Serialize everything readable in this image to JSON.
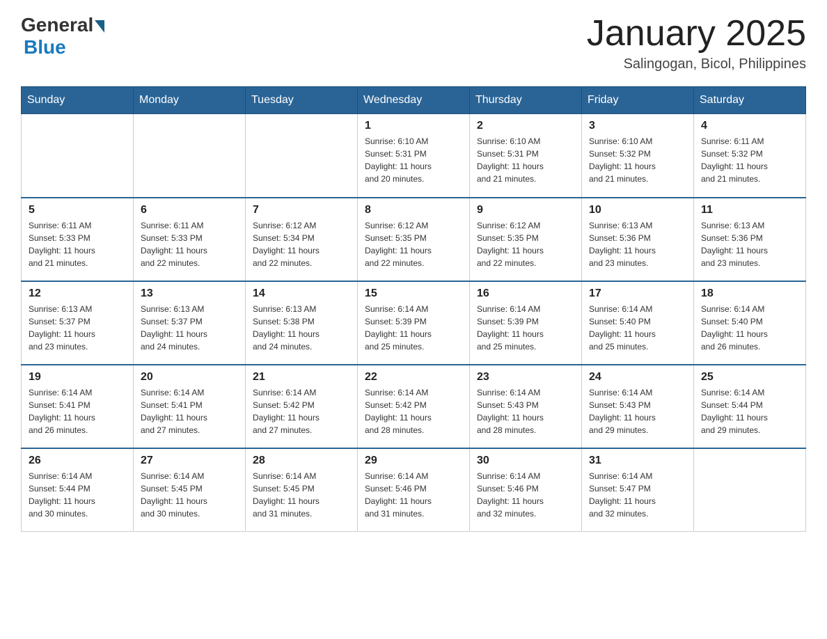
{
  "header": {
    "logo": {
      "text_general": "General",
      "text_blue": "Blue"
    },
    "title": "January 2025",
    "subtitle": "Salingogan, Bicol, Philippines"
  },
  "days_of_week": [
    "Sunday",
    "Monday",
    "Tuesday",
    "Wednesday",
    "Thursday",
    "Friday",
    "Saturday"
  ],
  "weeks": [
    {
      "days": [
        {
          "num": "",
          "info": ""
        },
        {
          "num": "",
          "info": ""
        },
        {
          "num": "",
          "info": ""
        },
        {
          "num": "1",
          "info": "Sunrise: 6:10 AM\nSunset: 5:31 PM\nDaylight: 11 hours\nand 20 minutes."
        },
        {
          "num": "2",
          "info": "Sunrise: 6:10 AM\nSunset: 5:31 PM\nDaylight: 11 hours\nand 21 minutes."
        },
        {
          "num": "3",
          "info": "Sunrise: 6:10 AM\nSunset: 5:32 PM\nDaylight: 11 hours\nand 21 minutes."
        },
        {
          "num": "4",
          "info": "Sunrise: 6:11 AM\nSunset: 5:32 PM\nDaylight: 11 hours\nand 21 minutes."
        }
      ]
    },
    {
      "days": [
        {
          "num": "5",
          "info": "Sunrise: 6:11 AM\nSunset: 5:33 PM\nDaylight: 11 hours\nand 21 minutes."
        },
        {
          "num": "6",
          "info": "Sunrise: 6:11 AM\nSunset: 5:33 PM\nDaylight: 11 hours\nand 22 minutes."
        },
        {
          "num": "7",
          "info": "Sunrise: 6:12 AM\nSunset: 5:34 PM\nDaylight: 11 hours\nand 22 minutes."
        },
        {
          "num": "8",
          "info": "Sunrise: 6:12 AM\nSunset: 5:35 PM\nDaylight: 11 hours\nand 22 minutes."
        },
        {
          "num": "9",
          "info": "Sunrise: 6:12 AM\nSunset: 5:35 PM\nDaylight: 11 hours\nand 22 minutes."
        },
        {
          "num": "10",
          "info": "Sunrise: 6:13 AM\nSunset: 5:36 PM\nDaylight: 11 hours\nand 23 minutes."
        },
        {
          "num": "11",
          "info": "Sunrise: 6:13 AM\nSunset: 5:36 PM\nDaylight: 11 hours\nand 23 minutes."
        }
      ]
    },
    {
      "days": [
        {
          "num": "12",
          "info": "Sunrise: 6:13 AM\nSunset: 5:37 PM\nDaylight: 11 hours\nand 23 minutes."
        },
        {
          "num": "13",
          "info": "Sunrise: 6:13 AM\nSunset: 5:37 PM\nDaylight: 11 hours\nand 24 minutes."
        },
        {
          "num": "14",
          "info": "Sunrise: 6:13 AM\nSunset: 5:38 PM\nDaylight: 11 hours\nand 24 minutes."
        },
        {
          "num": "15",
          "info": "Sunrise: 6:14 AM\nSunset: 5:39 PM\nDaylight: 11 hours\nand 25 minutes."
        },
        {
          "num": "16",
          "info": "Sunrise: 6:14 AM\nSunset: 5:39 PM\nDaylight: 11 hours\nand 25 minutes."
        },
        {
          "num": "17",
          "info": "Sunrise: 6:14 AM\nSunset: 5:40 PM\nDaylight: 11 hours\nand 25 minutes."
        },
        {
          "num": "18",
          "info": "Sunrise: 6:14 AM\nSunset: 5:40 PM\nDaylight: 11 hours\nand 26 minutes."
        }
      ]
    },
    {
      "days": [
        {
          "num": "19",
          "info": "Sunrise: 6:14 AM\nSunset: 5:41 PM\nDaylight: 11 hours\nand 26 minutes."
        },
        {
          "num": "20",
          "info": "Sunrise: 6:14 AM\nSunset: 5:41 PM\nDaylight: 11 hours\nand 27 minutes."
        },
        {
          "num": "21",
          "info": "Sunrise: 6:14 AM\nSunset: 5:42 PM\nDaylight: 11 hours\nand 27 minutes."
        },
        {
          "num": "22",
          "info": "Sunrise: 6:14 AM\nSunset: 5:42 PM\nDaylight: 11 hours\nand 28 minutes."
        },
        {
          "num": "23",
          "info": "Sunrise: 6:14 AM\nSunset: 5:43 PM\nDaylight: 11 hours\nand 28 minutes."
        },
        {
          "num": "24",
          "info": "Sunrise: 6:14 AM\nSunset: 5:43 PM\nDaylight: 11 hours\nand 29 minutes."
        },
        {
          "num": "25",
          "info": "Sunrise: 6:14 AM\nSunset: 5:44 PM\nDaylight: 11 hours\nand 29 minutes."
        }
      ]
    },
    {
      "days": [
        {
          "num": "26",
          "info": "Sunrise: 6:14 AM\nSunset: 5:44 PM\nDaylight: 11 hours\nand 30 minutes."
        },
        {
          "num": "27",
          "info": "Sunrise: 6:14 AM\nSunset: 5:45 PM\nDaylight: 11 hours\nand 30 minutes."
        },
        {
          "num": "28",
          "info": "Sunrise: 6:14 AM\nSunset: 5:45 PM\nDaylight: 11 hours\nand 31 minutes."
        },
        {
          "num": "29",
          "info": "Sunrise: 6:14 AM\nSunset: 5:46 PM\nDaylight: 11 hours\nand 31 minutes."
        },
        {
          "num": "30",
          "info": "Sunrise: 6:14 AM\nSunset: 5:46 PM\nDaylight: 11 hours\nand 32 minutes."
        },
        {
          "num": "31",
          "info": "Sunrise: 6:14 AM\nSunset: 5:47 PM\nDaylight: 11 hours\nand 32 minutes."
        },
        {
          "num": "",
          "info": ""
        }
      ]
    }
  ],
  "colors": {
    "header_bg": "#2a6496",
    "header_text": "#ffffff",
    "border": "#cccccc",
    "accent_blue": "#1a7abf"
  }
}
